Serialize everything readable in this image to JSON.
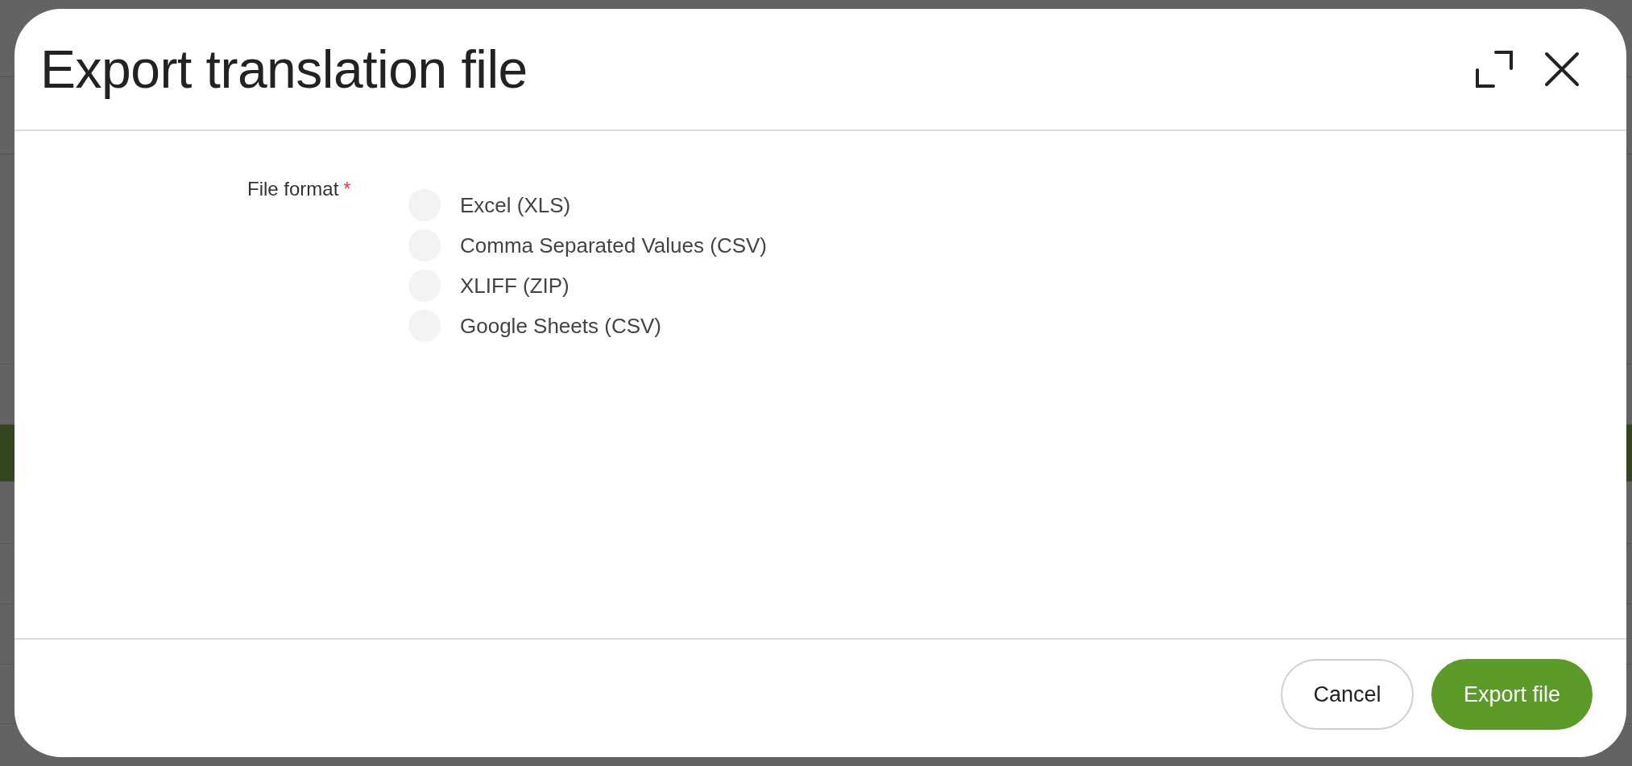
{
  "dialog": {
    "title": "Export translation file",
    "field": {
      "label": "File format",
      "required_mark": "*",
      "options": [
        {
          "label": "Excel (XLS)",
          "selected": false
        },
        {
          "label": "Comma Separated Values (CSV)",
          "selected": false
        },
        {
          "label": "XLIFF (ZIP)",
          "selected": false
        },
        {
          "label": "Google Sheets (CSV)",
          "selected": false
        }
      ]
    },
    "buttons": [
      {
        "label": "Cancel",
        "kind": "secondary"
      },
      {
        "label": "Export file",
        "kind": "primary"
      }
    ]
  }
}
